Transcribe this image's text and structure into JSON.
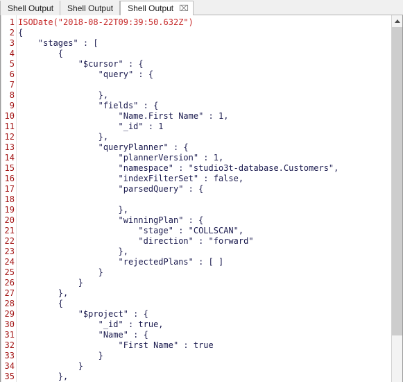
{
  "window": {
    "title": "Shell Output"
  },
  "tabs": [
    {
      "label": "Shell Output",
      "active": false,
      "closable": false
    },
    {
      "label": "Shell Output",
      "active": false,
      "closable": false
    },
    {
      "label": "Shell Output",
      "active": true,
      "closable": true,
      "close_icon": "close-tab-icon",
      "close_glyph": "⌧"
    }
  ],
  "colors": {
    "line_number": "#a31515",
    "code_text": "#1b1b4f",
    "string_text": "#c62828",
    "active_tab_bg": "#ffffff",
    "inactive_tab_bg": "#f0f0f0",
    "scrollbar_thumb": "#cdcdcd"
  },
  "editor": {
    "first_visible_line": 1,
    "last_visible_line": 35,
    "lines": [
      {
        "n": 1,
        "text": "ISODate(\"2018-08-22T09:39:50.632Z\")",
        "style": "str"
      },
      {
        "n": 2,
        "text": "{",
        "style": "code"
      },
      {
        "n": 3,
        "text": "    \"stages\" : [",
        "style": "code"
      },
      {
        "n": 4,
        "text": "        {",
        "style": "code"
      },
      {
        "n": 5,
        "text": "            \"$cursor\" : {",
        "style": "code"
      },
      {
        "n": 6,
        "text": "                \"query\" : {",
        "style": "code"
      },
      {
        "n": 7,
        "text": "",
        "style": "code"
      },
      {
        "n": 8,
        "text": "                },",
        "style": "code"
      },
      {
        "n": 9,
        "text": "                \"fields\" : {",
        "style": "code"
      },
      {
        "n": 10,
        "text": "                    \"Name.First Name\" : 1,",
        "style": "code"
      },
      {
        "n": 11,
        "text": "                    \"_id\" : 1",
        "style": "code"
      },
      {
        "n": 12,
        "text": "                },",
        "style": "code"
      },
      {
        "n": 13,
        "text": "                \"queryPlanner\" : {",
        "style": "code"
      },
      {
        "n": 14,
        "text": "                    \"plannerVersion\" : 1,",
        "style": "code"
      },
      {
        "n": 15,
        "text": "                    \"namespace\" : \"studio3t-database.Customers\",",
        "style": "code"
      },
      {
        "n": 16,
        "text": "                    \"indexFilterSet\" : false,",
        "style": "code"
      },
      {
        "n": 17,
        "text": "                    \"parsedQuery\" : {",
        "style": "code"
      },
      {
        "n": 18,
        "text": "",
        "style": "code"
      },
      {
        "n": 19,
        "text": "                    },",
        "style": "code"
      },
      {
        "n": 20,
        "text": "                    \"winningPlan\" : {",
        "style": "code"
      },
      {
        "n": 21,
        "text": "                        \"stage\" : \"COLLSCAN\",",
        "style": "code"
      },
      {
        "n": 22,
        "text": "                        \"direction\" : \"forward\"",
        "style": "code"
      },
      {
        "n": 23,
        "text": "                    },",
        "style": "code"
      },
      {
        "n": 24,
        "text": "                    \"rejectedPlans\" : [ ]",
        "style": "code"
      },
      {
        "n": 25,
        "text": "                }",
        "style": "code"
      },
      {
        "n": 26,
        "text": "            }",
        "style": "code"
      },
      {
        "n": 27,
        "text": "        },",
        "style": "code"
      },
      {
        "n": 28,
        "text": "        {",
        "style": "code"
      },
      {
        "n": 29,
        "text": "            \"$project\" : {",
        "style": "code"
      },
      {
        "n": 30,
        "text": "                \"_id\" : true,",
        "style": "code"
      },
      {
        "n": 31,
        "text": "                \"Name\" : {",
        "style": "code"
      },
      {
        "n": 32,
        "text": "                    \"First Name\" : true",
        "style": "code"
      },
      {
        "n": 33,
        "text": "                }",
        "style": "code"
      },
      {
        "n": 34,
        "text": "            }",
        "style": "code"
      },
      {
        "n": 35,
        "text": "        },",
        "style": "code"
      }
    ]
  },
  "scrollbar": {
    "up_arrow_icon": "scroll-up-arrow-icon",
    "orientation": "vertical"
  }
}
